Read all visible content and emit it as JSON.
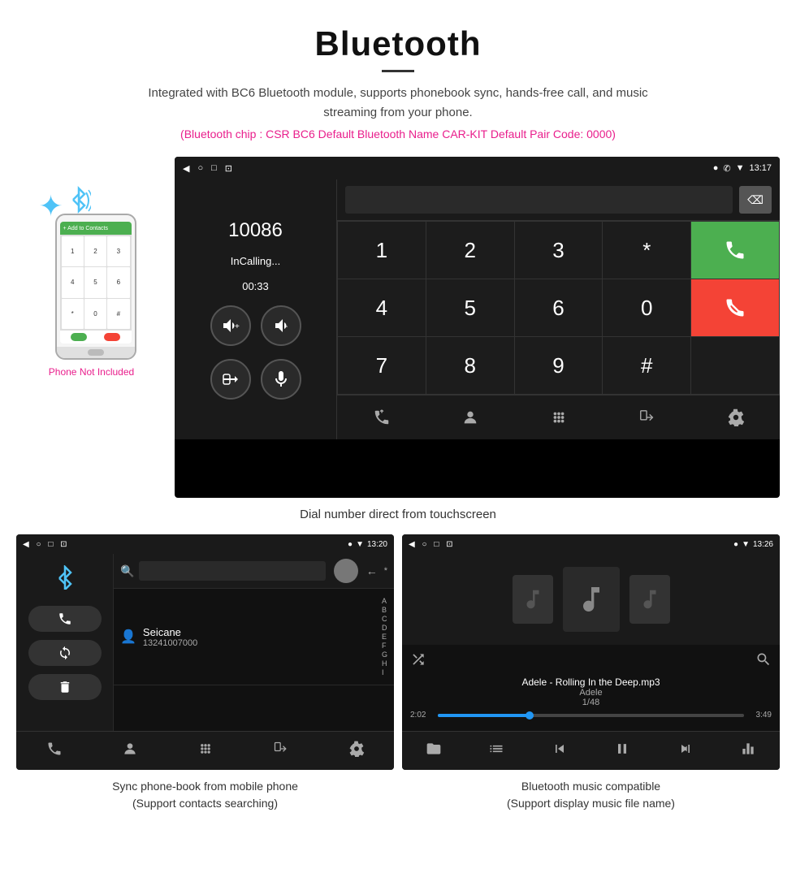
{
  "header": {
    "title": "Bluetooth",
    "description": "Integrated with BC6 Bluetooth module, supports phonebook sync, hands-free call, and music streaming from your phone.",
    "specs": "(Bluetooth chip : CSR BC6    Default Bluetooth Name CAR-KIT    Default Pair Code: 0000)"
  },
  "phone_label": "Phone Not Included",
  "dial_caption": "Dial number direct from touchscreen",
  "dial_screen": {
    "time": "13:17",
    "number": "10086",
    "status": "InCalling...",
    "timer": "00:33",
    "keys": [
      "1",
      "2",
      "3",
      "*",
      "4",
      "5",
      "6",
      "0",
      "7",
      "8",
      "9",
      "#"
    ]
  },
  "phonebook_caption": "Sync phone-book from mobile phone\n(Support contacts searching)",
  "music_caption": "Bluetooth music compatible\n(Support display music file name)",
  "phonebook_screen": {
    "time": "13:20",
    "contact_name": "Seicane",
    "contact_number": "13241007000",
    "alpha_letters": [
      "A",
      "B",
      "C",
      "D",
      "E",
      "F",
      "G",
      "H",
      "I"
    ]
  },
  "music_screen": {
    "time": "13:26",
    "track": "Adele - Rolling In the Deep.mp3",
    "artist": "Adele",
    "count": "1/48",
    "time_current": "2:02",
    "time_total": "3:49"
  }
}
